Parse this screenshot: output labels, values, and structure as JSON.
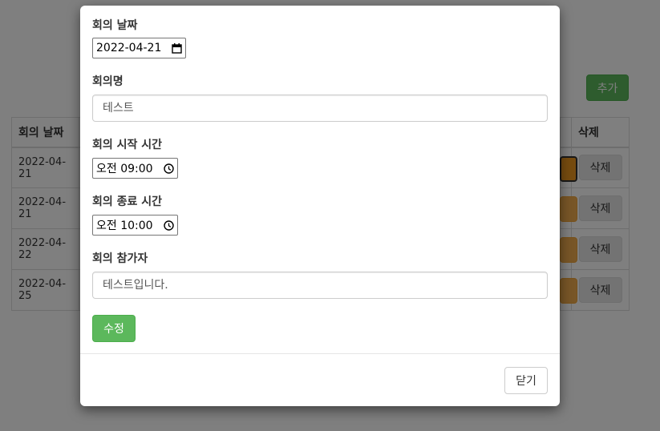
{
  "background": {
    "add_button_label": "추가",
    "table": {
      "headers": [
        "회의 날짜",
        "",
        "",
        "삭제"
      ],
      "rows": [
        {
          "date": "2022-04-21",
          "delete_label": "삭제"
        },
        {
          "date": "2022-04-21",
          "delete_label": "삭제"
        },
        {
          "date": "2022-04-22",
          "delete_label": "삭제"
        },
        {
          "date": "2022-04-25",
          "delete_label": "삭제"
        }
      ]
    }
  },
  "modal": {
    "date_label": "회의 날짜",
    "date_value": "2022-04-21",
    "name_label": "회의명",
    "name_value": "테스트",
    "start_label": "회의 시작 시간",
    "start_value": "오전 09:00",
    "end_label": "회의 종료 시간",
    "end_value": "오전 10:00",
    "participants_label": "회의 참가자",
    "participants_value": "테스트입니다.",
    "submit_label": "수정",
    "close_label": "닫기"
  },
  "colors": {
    "success": "#5cb85c",
    "warning": "#f0ad4e",
    "backdrop": "rgba(0,0,0,0.5)"
  }
}
